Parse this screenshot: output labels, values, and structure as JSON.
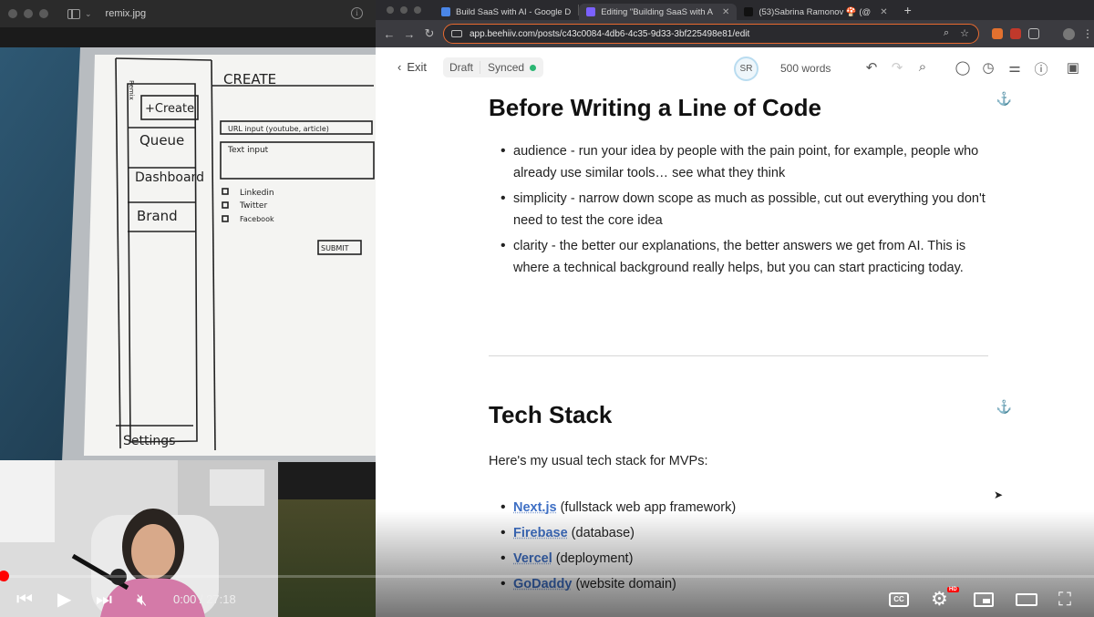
{
  "viewer": {
    "filename": "remix.jpg"
  },
  "wireframe": {
    "header": "CREATE",
    "side_label": "Remix",
    "nav": [
      "+Create",
      "Queue",
      "Dashboard",
      "Brand"
    ],
    "settings": "Settings",
    "url_input": "URL input (youtube, article)",
    "text_input": "Text input",
    "checkboxes": [
      "Linkedin",
      "Twitter",
      "Facebook"
    ],
    "submit": "SUBMIT"
  },
  "browser": {
    "tabs": [
      {
        "label": "Build SaaS with AI - Google D",
        "favicon_color": "#4a86e8",
        "active": false
      },
      {
        "label": "Editing \"Building SaaS with A",
        "favicon_color": "#7b61ff",
        "active": true
      },
      {
        "label": "(53)Sabrina Ramonov 🍄 (@",
        "favicon_color": "#111111",
        "active": false
      }
    ],
    "new_tab": "+",
    "url": "app.beehiiv.com/posts/c43c0084-4db6-4c35-9d33-3bf225498e81/edit"
  },
  "editor": {
    "exit_label": "Exit",
    "status_draft": "Draft",
    "status_synced": "Synced",
    "avatar_initials": "SR",
    "word_count": "500 words",
    "section1": {
      "title": "Before Writing a Line of Code",
      "bullets": [
        "audience - run your idea by people with the pain point, for example, people who already use similar tools… see what they think",
        "simplicity - narrow down scope as much as possible, cut out everything you don't need to test the core idea",
        "clarity - the better our explanations, the better answers we get from AI. This is where a technical background really helps, but you can start practicing today."
      ]
    },
    "section2": {
      "title": "Tech Stack",
      "intro": "Here's my usual tech stack for MVPs:",
      "items": [
        {
          "name": "Next.js",
          "desc": " (fullstack web app framework)"
        },
        {
          "name": "Firebase",
          "desc": " (database)"
        },
        {
          "name": "Vercel",
          "desc": " (deployment)"
        },
        {
          "name": "GoDaddy",
          "desc": " (website domain)"
        }
      ]
    }
  },
  "player": {
    "time": "0:00 / 27:18",
    "cc": "CC",
    "hd": "HD",
    "progress": 0.0
  }
}
